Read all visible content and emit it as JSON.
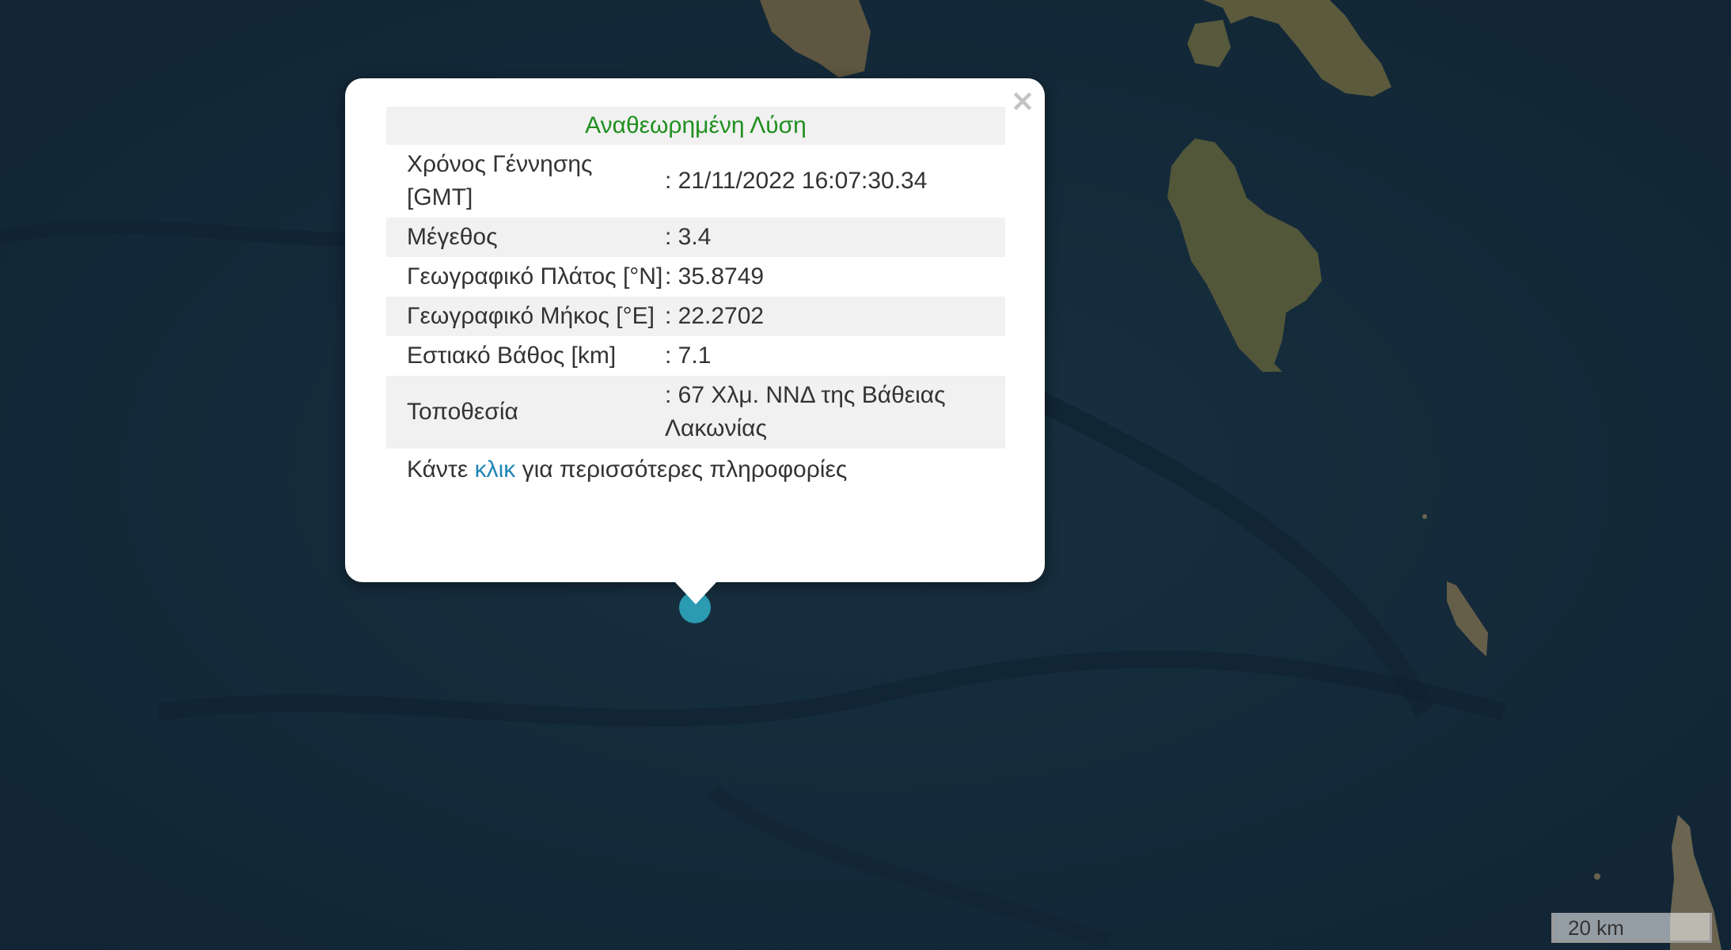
{
  "map": {
    "icons": {
      "marker": "earthquake-epicenter-marker",
      "close": "close-icon"
    },
    "colors": {
      "sea": "#14293a",
      "land": "#5b5a3d",
      "marker": "#2a9bb0",
      "heading": "#1f8f1f",
      "link": "#1f86b8"
    }
  },
  "popup": {
    "close_glyph": "×",
    "heading": "Αναθεωρημένη Λύση",
    "rows": [
      {
        "label": "Χρόνος Γέννησης [GMT]",
        "value": ": 21/11/2022 16:07:30.34"
      },
      {
        "label": "Μέγεθος",
        "value": ": 3.4"
      },
      {
        "label": "Γεωγραφικό Πλάτος [°N]",
        "value": ": 35.8749"
      },
      {
        "label": "Γεωγραφικό Μήκος [°E]",
        "value": ": 22.2702"
      },
      {
        "label": "Εστιακό Βάθος [km]",
        "value": ": 7.1"
      },
      {
        "label": "Τοποθεσία",
        "value": ": 67 Χλμ. ΝΝΔ της Βάθειας Λακωνίας"
      }
    ],
    "more": {
      "prefix": "Κάντε",
      "link": "κλικ",
      "suffix": "για περισσότερες πληροφορίες"
    }
  },
  "scale_bar": {
    "label": "20 km"
  }
}
